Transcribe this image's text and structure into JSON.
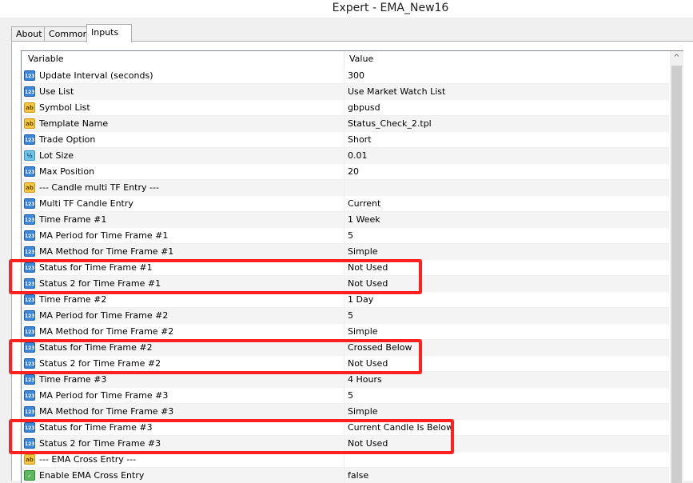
{
  "window": {
    "title": "Expert - EMA_New16"
  },
  "tabs": [
    {
      "label": "About",
      "active": false
    },
    {
      "label": "Common",
      "active": false
    },
    {
      "label": "Inputs",
      "active": true
    }
  ],
  "grid": {
    "columns": {
      "variable": "Variable",
      "value": "Value"
    },
    "rows": [
      {
        "icon": "int",
        "icon_text": "123",
        "variable": "Update Interval (seconds)",
        "value": "300"
      },
      {
        "icon": "int",
        "icon_text": "123",
        "variable": "Use List",
        "value": "Use Market Watch List"
      },
      {
        "icon": "string",
        "icon_text": "ab",
        "variable": "Symbol List",
        "value": "gbpusd"
      },
      {
        "icon": "string",
        "icon_text": "ab",
        "variable": "Template Name",
        "value": "Status_Check_2.tpl"
      },
      {
        "icon": "int",
        "icon_text": "123",
        "variable": "Trade Option",
        "value": "Short"
      },
      {
        "icon": "double",
        "icon_text": "½",
        "variable": "Lot Size",
        "value": "0.01"
      },
      {
        "icon": "int",
        "icon_text": "123",
        "variable": "Max Position",
        "value": "20"
      },
      {
        "icon": "string",
        "icon_text": "ab",
        "variable": "--- Candle multi TF Entry ---",
        "value": ""
      },
      {
        "icon": "int",
        "icon_text": "123",
        "variable": "Multi TF Candle Entry",
        "value": "Current"
      },
      {
        "icon": "int",
        "icon_text": "123",
        "variable": "Time Frame #1",
        "value": "1 Week"
      },
      {
        "icon": "int",
        "icon_text": "123",
        "variable": "MA Period for Time Frame #1",
        "value": "5"
      },
      {
        "icon": "int",
        "icon_text": "123",
        "variable": "MA Method for Time Frame #1",
        "value": "Simple"
      },
      {
        "icon": "int",
        "icon_text": "123",
        "variable": "Status for Time Frame #1",
        "value": "Not Used"
      },
      {
        "icon": "int",
        "icon_text": "123",
        "variable": "Status 2 for Time Frame #1",
        "value": "Not Used"
      },
      {
        "icon": "int",
        "icon_text": "123",
        "variable": "Time Frame #2",
        "value": "1 Day"
      },
      {
        "icon": "int",
        "icon_text": "123",
        "variable": "MA Period for Time Frame #2",
        "value": "5"
      },
      {
        "icon": "int",
        "icon_text": "123",
        "variable": "MA Method for Time Frame #2",
        "value": "Simple"
      },
      {
        "icon": "int",
        "icon_text": "123",
        "variable": "Status for Time Frame #2",
        "value": "Crossed Below"
      },
      {
        "icon": "int",
        "icon_text": "123",
        "variable": "Status 2 for Time Frame #2",
        "value": "Not Used"
      },
      {
        "icon": "int",
        "icon_text": "123",
        "variable": "Time Frame #3",
        "value": "4 Hours"
      },
      {
        "icon": "int",
        "icon_text": "123",
        "variable": "MA Period for Time Frame #3",
        "value": "5"
      },
      {
        "icon": "int",
        "icon_text": "123",
        "variable": "MA Method for Time Frame #3",
        "value": "Simple"
      },
      {
        "icon": "int",
        "icon_text": "123",
        "variable": "Status for Time Frame #3",
        "value": "Current Candle Is Below"
      },
      {
        "icon": "int",
        "icon_text": "123",
        "variable": "Status 2 for Time Frame #3",
        "value": "Not Used"
      },
      {
        "icon": "string",
        "icon_text": "ab",
        "variable": "--- EMA Cross Entry ---",
        "value": ""
      },
      {
        "icon": "bool",
        "icon_text": "✓",
        "variable": "Enable EMA Cross Entry",
        "value": "false"
      }
    ]
  },
  "highlights": {
    "color": "#ff2020"
  },
  "colors": {
    "int_icon": "#3c86d6",
    "string_icon": "#f4c542",
    "double_icon": "#6fc3e8",
    "bool_icon": "#5fb85f"
  }
}
